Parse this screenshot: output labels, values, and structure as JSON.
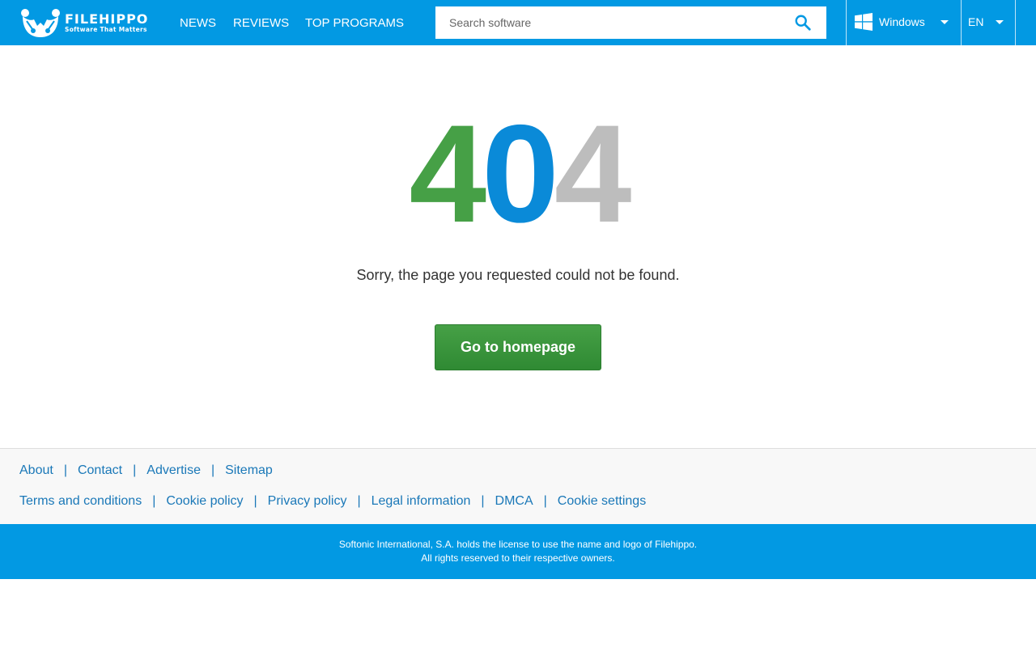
{
  "header": {
    "logo": {
      "name": "FILEHIPPO",
      "tagline": "Software That Matters"
    },
    "nav": [
      {
        "label": "NEWS"
      },
      {
        "label": "REVIEWS"
      },
      {
        "label": "TOP PROGRAMS"
      }
    ],
    "search": {
      "placeholder": "Search software",
      "icon": "search-icon"
    },
    "platform": {
      "label": "Windows",
      "icon": "windows-icon"
    },
    "language": {
      "label": "EN"
    }
  },
  "main": {
    "error_code": {
      "d1": "4",
      "d2": "0",
      "d3": "4"
    },
    "message": "Sorry, the page you requested could not be found.",
    "button_label": "Go to homepage"
  },
  "footer": {
    "row1": [
      "About",
      "Contact",
      "Advertise",
      "Sitemap"
    ],
    "row2": [
      "Terms and conditions",
      "Cookie policy",
      "Privacy policy",
      "Legal information",
      "DMCA",
      "Cookie settings"
    ],
    "separator": "|",
    "legal_line1": "Softonic International, S.A. holds the license to use the name and logo of Filehippo.",
    "legal_line2": "All rights reserved to their respective owners."
  },
  "colors": {
    "brand_blue": "#0299e3",
    "digit_green": "#46a046",
    "digit_blue": "#0a8ad8",
    "digit_gray": "#bdbdbd",
    "button_green": "#3a9a3d",
    "link_blue": "#1a78b8"
  }
}
